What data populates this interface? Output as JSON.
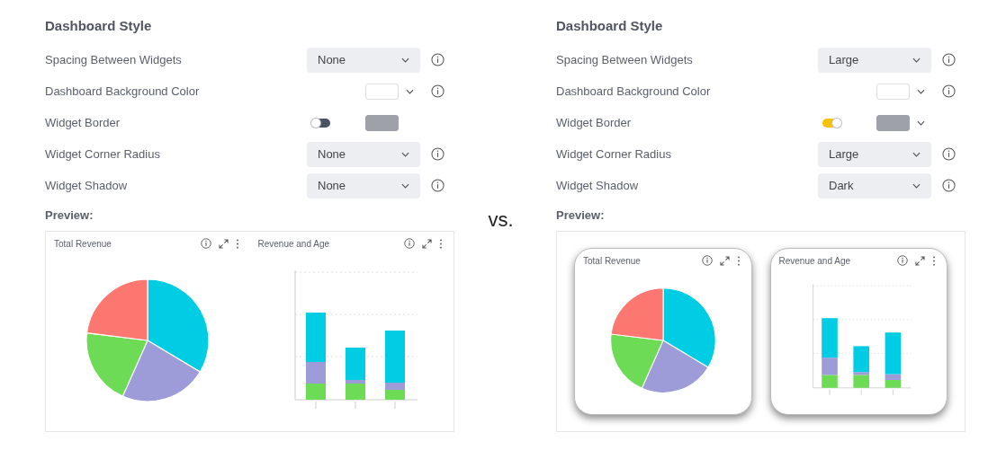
{
  "panels": [
    {
      "title": "Dashboard Style",
      "rows": [
        {
          "kind": "select",
          "label": "Spacing Between Widgets",
          "value": "None",
          "info": true
        },
        {
          "kind": "color",
          "label": "Dashboard Background Color",
          "chevron": true,
          "info": true
        },
        {
          "kind": "toggle",
          "label": "Widget Border",
          "on": false,
          "chevron": false,
          "info": false
        },
        {
          "kind": "select",
          "label": "Widget Corner Radius",
          "value": "None",
          "info": true
        },
        {
          "kind": "select",
          "label": "Widget Shadow",
          "value": "None",
          "info": true
        }
      ],
      "preview_label": "Preview:",
      "preview": {
        "kind": "flat",
        "widgets": [
          {
            "title": "Total Revenue",
            "kind": "pie"
          },
          {
            "title": "Revenue and Age",
            "kind": "bar"
          }
        ]
      }
    },
    {
      "title": "Dashboard Style",
      "rows": [
        {
          "kind": "select",
          "label": "Spacing Between Widgets",
          "value": "Large",
          "info": true
        },
        {
          "kind": "color",
          "label": "Dashboard Background Color",
          "chevron": true,
          "info": true
        },
        {
          "kind": "toggle",
          "label": "Widget Border",
          "on": true,
          "chevron": true,
          "info": false
        },
        {
          "kind": "select",
          "label": "Widget Corner Radius",
          "value": "Large",
          "info": true
        },
        {
          "kind": "select",
          "label": "Widget Shadow",
          "value": "Dark",
          "info": true
        }
      ],
      "preview_label": "Preview:",
      "preview": {
        "kind": "card",
        "widgets": [
          {
            "title": "Total Revenue",
            "kind": "pie"
          },
          {
            "title": "Revenue and Age",
            "kind": "bar"
          }
        ]
      }
    }
  ],
  "separator": "vs."
}
